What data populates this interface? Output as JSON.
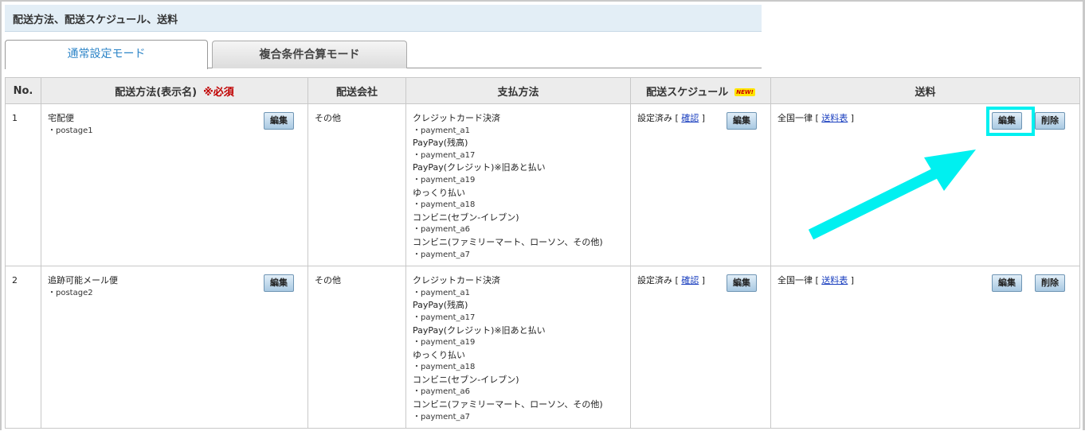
{
  "header": {
    "title": "配送方法、配送スケジュール、送料"
  },
  "tabs": [
    {
      "label": "通常設定モード"
    },
    {
      "label": "複合条件合算モード"
    }
  ],
  "columns": {
    "no": "No.",
    "method": "配送方法(表示名)",
    "required": "※必須",
    "company": "配送会社",
    "payment": "支払方法",
    "schedule": "配送スケジュール",
    "new_badge": "NEW!",
    "fee": "送料"
  },
  "buttons": {
    "edit": "編集",
    "delete": "削除"
  },
  "rows": [
    {
      "no": "1",
      "method_name": "宅配便",
      "method_code": "・postage1",
      "company": "その他",
      "payments": [
        {
          "name": "クレジットカード決済",
          "code": "・payment_a1"
        },
        {
          "name": "PayPay(残高)",
          "code": "・payment_a17"
        },
        {
          "name": "PayPay(クレジット)※旧あと払い",
          "code": "・payment_a19"
        },
        {
          "name": "ゆっくり払い",
          "code": "・payment_a18"
        },
        {
          "name": "コンビニ(セブン-イレブン)",
          "code": "・payment_a6"
        },
        {
          "name": "コンビニ(ファミリーマート、ローソン、その他)",
          "code": "・payment_a7"
        }
      ],
      "schedule_status": "設定済み",
      "schedule_link": "確認",
      "fee_text": "全国一律",
      "fee_link": "送料表"
    },
    {
      "no": "2",
      "method_name": "追跡可能メール便",
      "method_code": "・postage2",
      "company": "その他",
      "payments": [
        {
          "name": "クレジットカード決済",
          "code": "・payment_a1"
        },
        {
          "name": "PayPay(残高)",
          "code": "・payment_a17"
        },
        {
          "name": "PayPay(クレジット)※旧あと払い",
          "code": "・payment_a19"
        },
        {
          "name": "ゆっくり払い",
          "code": "・payment_a18"
        },
        {
          "name": "コンビニ(セブン-イレブン)",
          "code": "・payment_a6"
        },
        {
          "name": "コンビニ(ファミリーマート、ローソン、その他)",
          "code": "・payment_a7"
        }
      ],
      "schedule_status": "設定済み",
      "schedule_link": "確認",
      "fee_text": "全国一律",
      "fee_link": "送料表"
    }
  ],
  "colors": {
    "annotation": "#00f0f0",
    "required": "#c00000",
    "tab_active_text": "#2f86c8"
  }
}
